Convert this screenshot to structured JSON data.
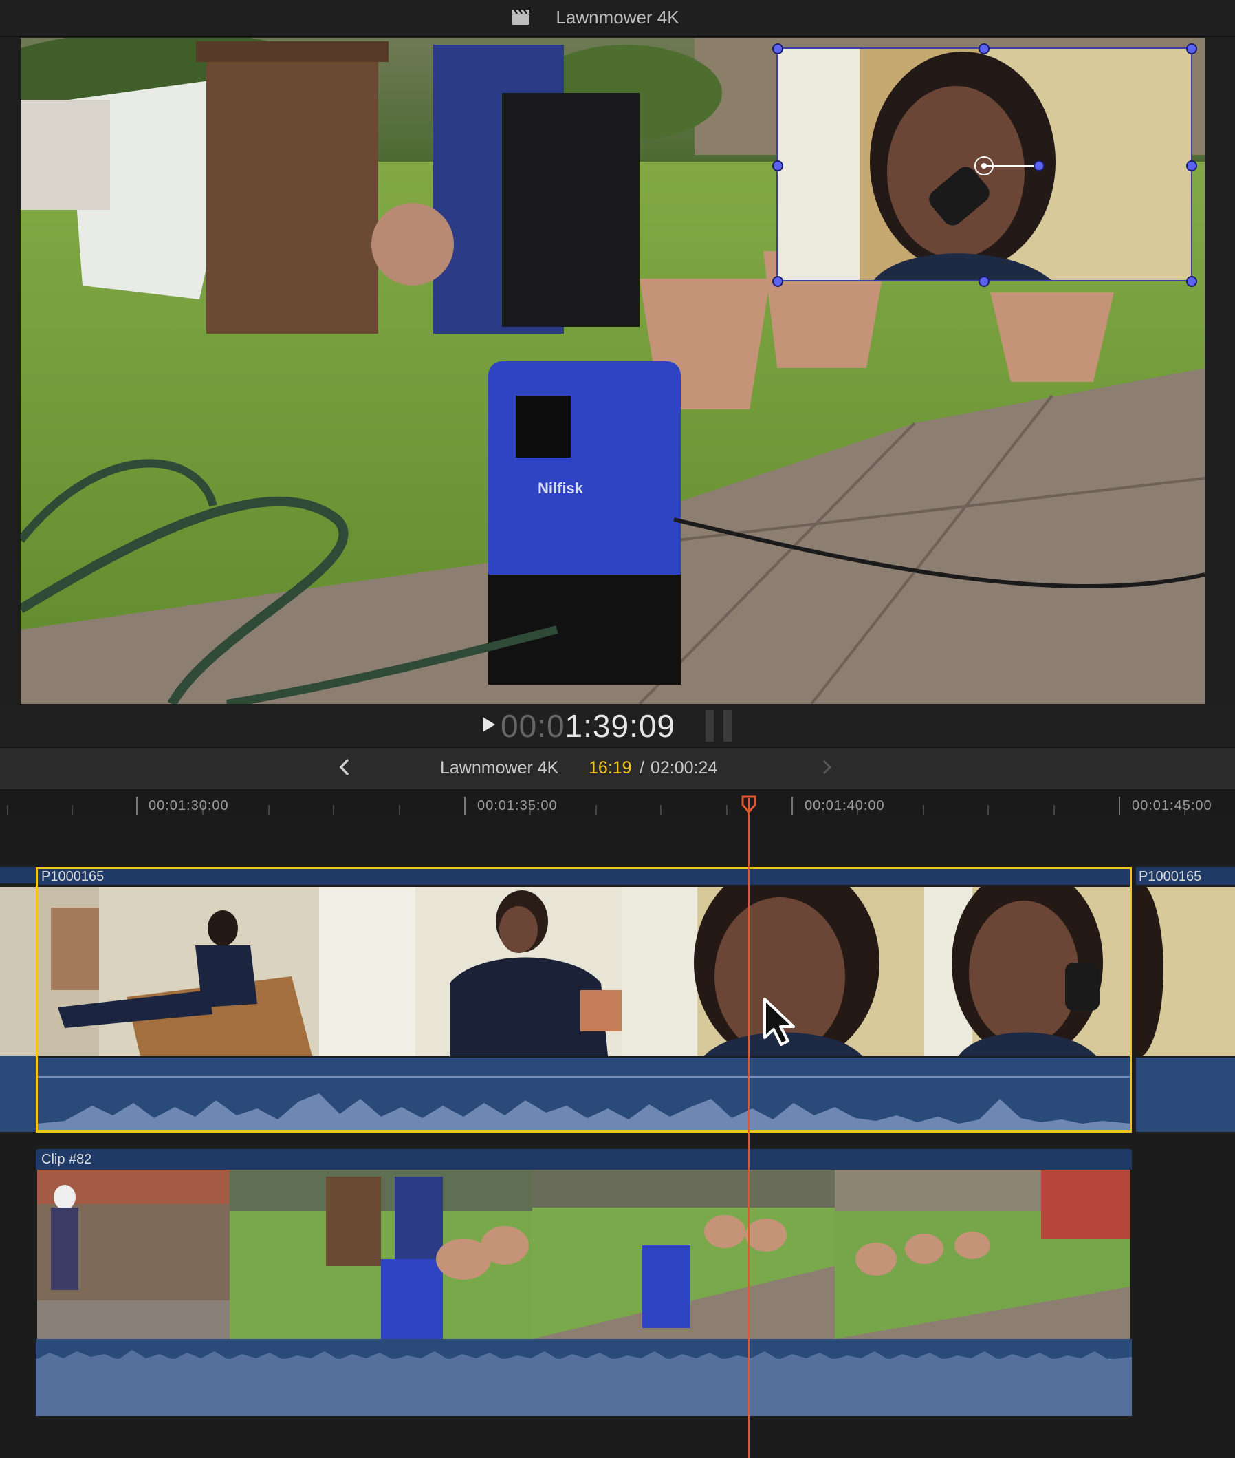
{
  "window": {
    "title": "Lawnmower 4K"
  },
  "transport": {
    "timecode_dim": "00:0",
    "timecode_main": "1:39:09"
  },
  "timeline_header": {
    "project_name": "Lawnmower 4K",
    "playhead_time": "16:19",
    "separator": "/",
    "duration": "02:00:24"
  },
  "ruler": {
    "labels": [
      "00:01:30:00",
      "00:01:35:00",
      "00:01:40:00",
      "00:01:45:00"
    ]
  },
  "primary_track": {
    "clip_name": "P1000165",
    "next_clip_name": "P1000165"
  },
  "connected_track": {
    "clip_name": "Clip #82"
  },
  "colors": {
    "selection": "#f0c419",
    "playhead": "#e2572f",
    "clip_header": "#1f3a66",
    "audio_dark": "#2a4a7a",
    "audio_wave": "#6f87b3",
    "connected_audio": "#56709e",
    "handle": "#4a55e6"
  },
  "icons": [
    "clapper-icon",
    "play-icon",
    "back-arrow-icon",
    "forward-arrow-icon",
    "playhead-icon",
    "pointer-cursor-icon",
    "transform-anchor-icon"
  ]
}
